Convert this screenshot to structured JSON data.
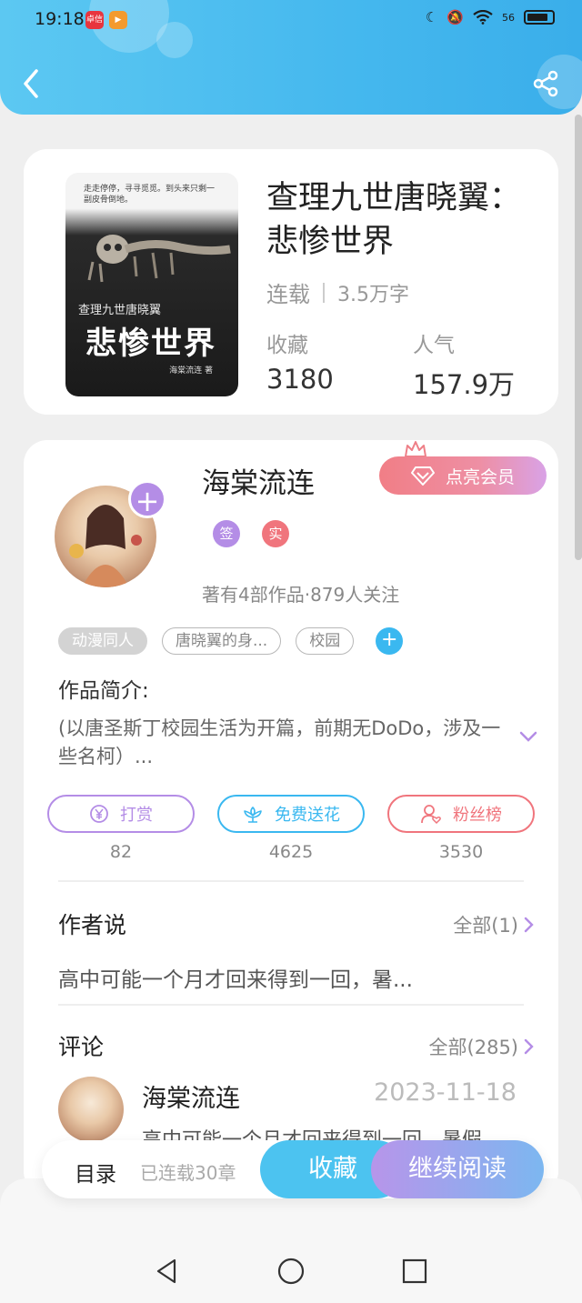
{
  "status_bar": {
    "time": "19:18",
    "app_icon_1": "卓信",
    "app_icon_2": "▶",
    "network": "56"
  },
  "header": {
    "back_icon": "back-chevron-icon",
    "share_icon": "share-icon"
  },
  "book": {
    "cover": {
      "tagline": "走走停停，寻寻觅觅。到头来只剩一副皮骨倒地。",
      "subtitle": "查理九世唐晓翼",
      "title": "悲惨世界",
      "author": "海棠流连 著"
    },
    "title": "查理九世唐晓翼：悲惨世界",
    "status": "连载",
    "word_count": "3.5万字",
    "stats": [
      {
        "label": "收藏",
        "value": "3180"
      },
      {
        "label": "人气",
        "value": "157.9万"
      }
    ]
  },
  "author": {
    "name": "海棠流连",
    "follow_icon": "plus-icon",
    "vip_label": "点亮会员",
    "badges": [
      {
        "label": "签",
        "color": "#b48de6"
      },
      {
        "label": "实",
        "color": "#f0757d"
      }
    ],
    "stats_text": "著有4部作品·879人关注"
  },
  "tags": [
    {
      "label": "动漫同人",
      "filled": true
    },
    {
      "label": "唐晓翼的身...",
      "filled": false
    },
    {
      "label": "校园",
      "filled": false
    }
  ],
  "intro": {
    "label": "作品简介:",
    "text": "(以唐圣斯丁校园生活为开篇，前期无DoDo，涉及一些名柯）..."
  },
  "actions": [
    {
      "label": "打赏",
      "count": "82",
      "color": "#b48de6",
      "icon": "yuan-coin-icon"
    },
    {
      "label": "免费送花",
      "count": "4625",
      "color": "#3ab8f0",
      "icon": "flower-icon"
    },
    {
      "label": "粉丝榜",
      "count": "3530",
      "color": "#f0757d",
      "icon": "fan-user-icon"
    }
  ],
  "author_says": {
    "title": "作者说",
    "more": "全部(1)",
    "text": "高中可能一个月才回来得到一回，暑..."
  },
  "comments": {
    "title": "评论",
    "more": "全部(285)",
    "first": {
      "name": "海棠流连",
      "date": "2023-11-18",
      "text": "高中可能一个月才回来得到一回，暑假"
    }
  },
  "bottom_bar": {
    "toc_label": "目录",
    "chapters": "已连载30章",
    "fav_label": "收藏",
    "read_label": "继续阅读"
  }
}
